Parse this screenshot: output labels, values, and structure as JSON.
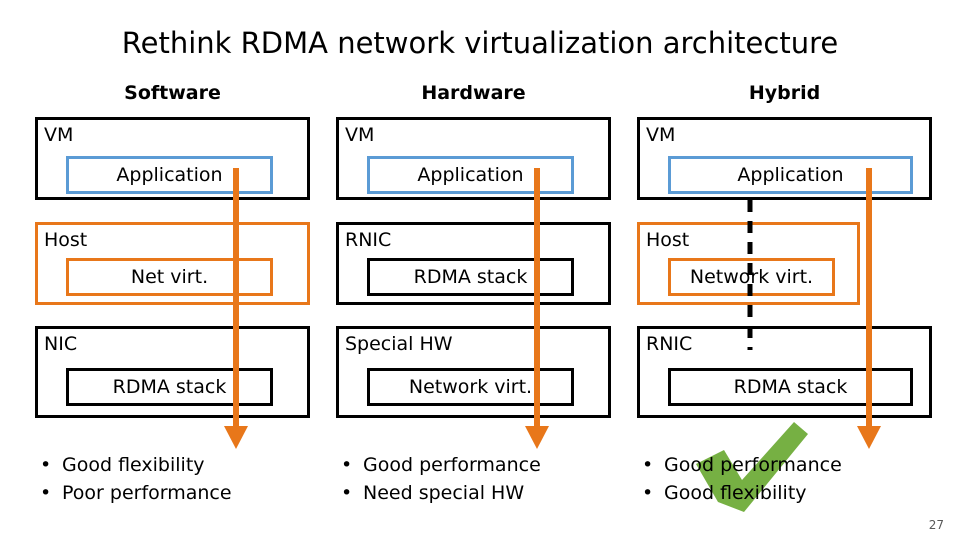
{
  "slide": {
    "title": "Rethink RDMA network virtualization architecture",
    "page_number": "27",
    "columns": [
      {
        "header": "Software",
        "layers": [
          {
            "outer_label": "VM",
            "inner_label": "Application",
            "outer_color": "#000000",
            "inner_color": "#5B9BD5"
          },
          {
            "outer_label": "Host",
            "inner_label": "Net virt.",
            "outer_color": "#E8771A",
            "inner_color": "#E8771A"
          },
          {
            "outer_label": "NIC",
            "inner_label": "RDMA stack",
            "outer_color": "#000000",
            "inner_color": "#000000"
          }
        ],
        "bullets": [
          "Good flexibility",
          "Poor performance"
        ]
      },
      {
        "header": "Hardware",
        "layers": [
          {
            "outer_label": "VM",
            "inner_label": "Application",
            "outer_color": "#000000",
            "inner_color": "#5B9BD5"
          },
          {
            "outer_label": "RNIC",
            "inner_label": "RDMA stack",
            "outer_color": "#000000",
            "inner_color": "#000000"
          },
          {
            "outer_label": "Special HW",
            "inner_label": "Network virt.",
            "outer_color": "#000000",
            "inner_color": "#000000"
          }
        ],
        "bullets": [
          "Good performance",
          "Need special HW"
        ]
      },
      {
        "header": "Hybrid",
        "layers": [
          {
            "outer_label": "VM",
            "inner_label": "Application",
            "outer_color": "#000000",
            "inner_color": "#5B9BD5"
          },
          {
            "outer_label": "Host",
            "inner_label": "Network virt.",
            "outer_color": "#E8771A",
            "inner_color": "#E8771A"
          },
          {
            "outer_label": "RNIC",
            "inner_label": "RDMA stack",
            "outer_color": "#000000",
            "inner_color": "#000000"
          }
        ],
        "bullets": [
          "Good performance",
          "Good flexibility"
        ]
      }
    ],
    "bullet_marker": "•",
    "check_mark_color": "#76B043",
    "arrow_color": "#E8771A"
  }
}
